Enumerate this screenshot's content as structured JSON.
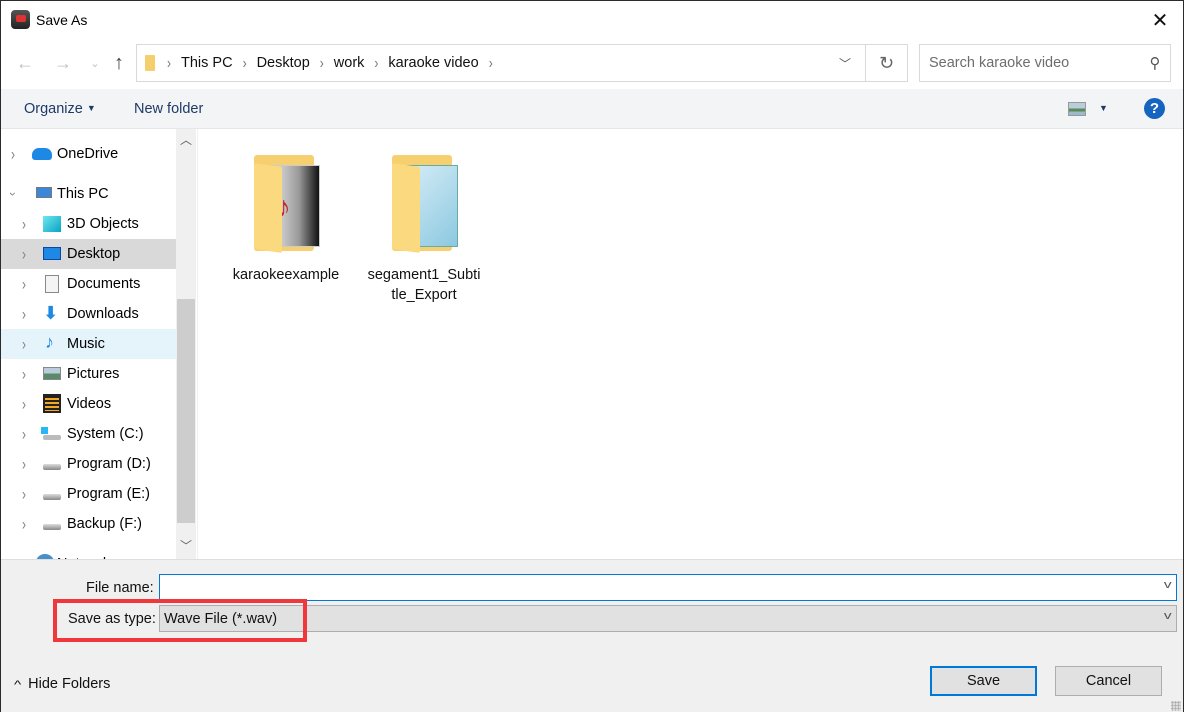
{
  "window": {
    "title": "Save As",
    "close_icon": "close-icon"
  },
  "navigation": {
    "back_icon": "arrow-left-icon",
    "forward_icon": "arrow-right-icon",
    "recent_icon": "chevron-down-icon",
    "up_icon": "arrow-up-icon",
    "breadcrumb": [
      "This PC",
      "Desktop",
      "work",
      "karaoke video"
    ],
    "refresh_icon": "refresh-icon",
    "search_placeholder": "Search karaoke video"
  },
  "toolbar": {
    "organize_label": "Organize",
    "new_folder_label": "New folder"
  },
  "nav_pane": {
    "items": [
      {
        "label": "OneDrive",
        "icon": "cloud-icon",
        "expanded": false,
        "level": 0
      },
      {
        "label": "This PC",
        "icon": "computer-icon",
        "expanded": true,
        "level": 0
      },
      {
        "label": "3D Objects",
        "icon": "cube-icon",
        "level": 1
      },
      {
        "label": "Desktop",
        "icon": "desktop-icon",
        "level": 1,
        "selected": true
      },
      {
        "label": "Documents",
        "icon": "documents-icon",
        "level": 1
      },
      {
        "label": "Downloads",
        "icon": "download-icon",
        "level": 1
      },
      {
        "label": "Music",
        "icon": "music-icon",
        "level": 1,
        "hover": true
      },
      {
        "label": "Pictures",
        "icon": "pictures-icon",
        "level": 1
      },
      {
        "label": "Videos",
        "icon": "videos-icon",
        "level": 1
      },
      {
        "label": "System (C:)",
        "icon": "system-drive-icon",
        "level": 1
      },
      {
        "label": "Program (D:)",
        "icon": "drive-icon",
        "level": 1
      },
      {
        "label": "Program (E:)",
        "icon": "drive-icon",
        "level": 1
      },
      {
        "label": "Backup (F:)",
        "icon": "drive-icon",
        "level": 1
      },
      {
        "label": "Network",
        "icon": "network-icon",
        "level": 0
      }
    ]
  },
  "files": [
    {
      "name": "karaokeexample",
      "type": "music-folder"
    },
    {
      "name": "segament1_Subtitle_Export",
      "name_line1": "segament1_Subti",
      "name_line2": "tle_Export",
      "type": "notepad-folder"
    }
  ],
  "form": {
    "file_name_label": "File name:",
    "file_name_value": "",
    "save_as_type_label": "Save as type:",
    "save_as_type_value": "Wave File (*.wav)"
  },
  "footer": {
    "hide_folders_label": "Hide Folders",
    "save_label": "Save",
    "cancel_label": "Cancel"
  },
  "colors": {
    "accent": "#0078d7",
    "highlight_box": "#f0383c",
    "selected_bg": "#d9d9d9",
    "hover_bg": "#e5f3fb"
  }
}
